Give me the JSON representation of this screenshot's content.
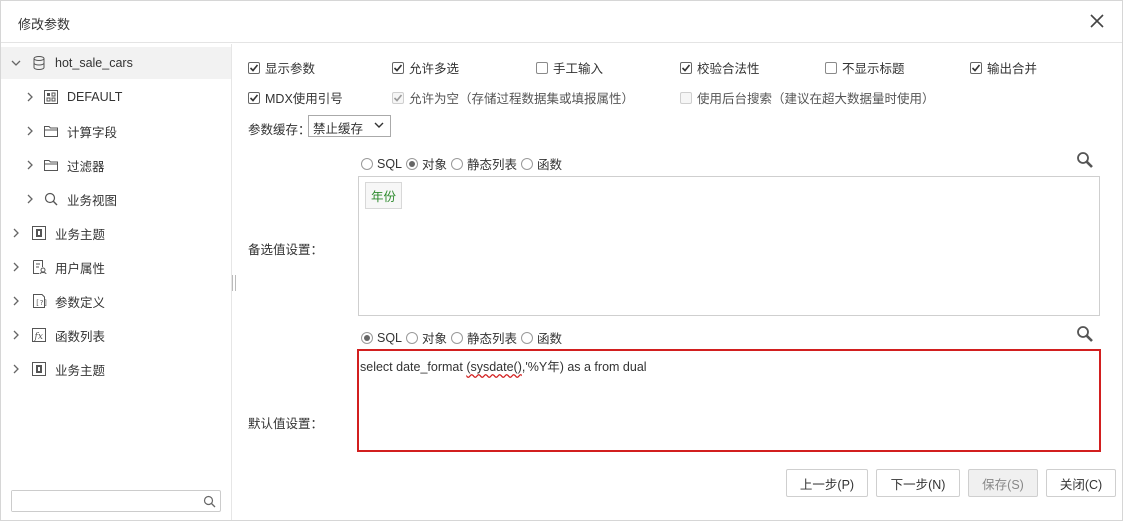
{
  "dialog": {
    "title": "修改参数"
  },
  "tree": {
    "root": "hot_sale_cars",
    "children": [
      "DEFAULT",
      "计算字段",
      "过滤器",
      "业务视图"
    ],
    "nodes": [
      "业务主题",
      "用户属性",
      "参数定义",
      "函数列表",
      "业务主题"
    ],
    "search_placeholder": ""
  },
  "options": {
    "row1": [
      {
        "label": "显示参数",
        "checked": true
      },
      {
        "label": "允许多选",
        "checked": true
      },
      {
        "label": "手工输入",
        "checked": false
      },
      {
        "label": "校验合法性",
        "checked": true
      },
      {
        "label": "不显示标题",
        "checked": false
      },
      {
        "label": "输出合并",
        "checked": true
      }
    ],
    "row2": [
      {
        "label": "MDX使用引号",
        "checked": true
      },
      {
        "label": "允许为空（存储过程数据集或填报属性）",
        "checked": true,
        "disabled": true
      },
      {
        "label": "使用后台搜索（建议在超大数据量时使用）",
        "checked": false,
        "disabled": true
      }
    ]
  },
  "cache": {
    "label": "参数缓存：",
    "value": "禁止缓存"
  },
  "candidate": {
    "label": "备选值设置：",
    "radios": [
      "SQL",
      "对象",
      "静态列表",
      "函数"
    ],
    "selected": "对象",
    "chip": "年份"
  },
  "default_value": {
    "label": "默认值设置：",
    "radios": [
      "SQL",
      "对象",
      "静态列表",
      "函数"
    ],
    "selected": "SQL",
    "sql_prefix": "select date_format ",
    "sql_squiggle": "(sysdate()",
    "sql_suffix": ",'%Y年) as a from dual"
  },
  "buttons": {
    "prev": "上一步(P)",
    "next": "下一步(N)",
    "save": "保存(S)",
    "close": "关闭(C)"
  }
}
